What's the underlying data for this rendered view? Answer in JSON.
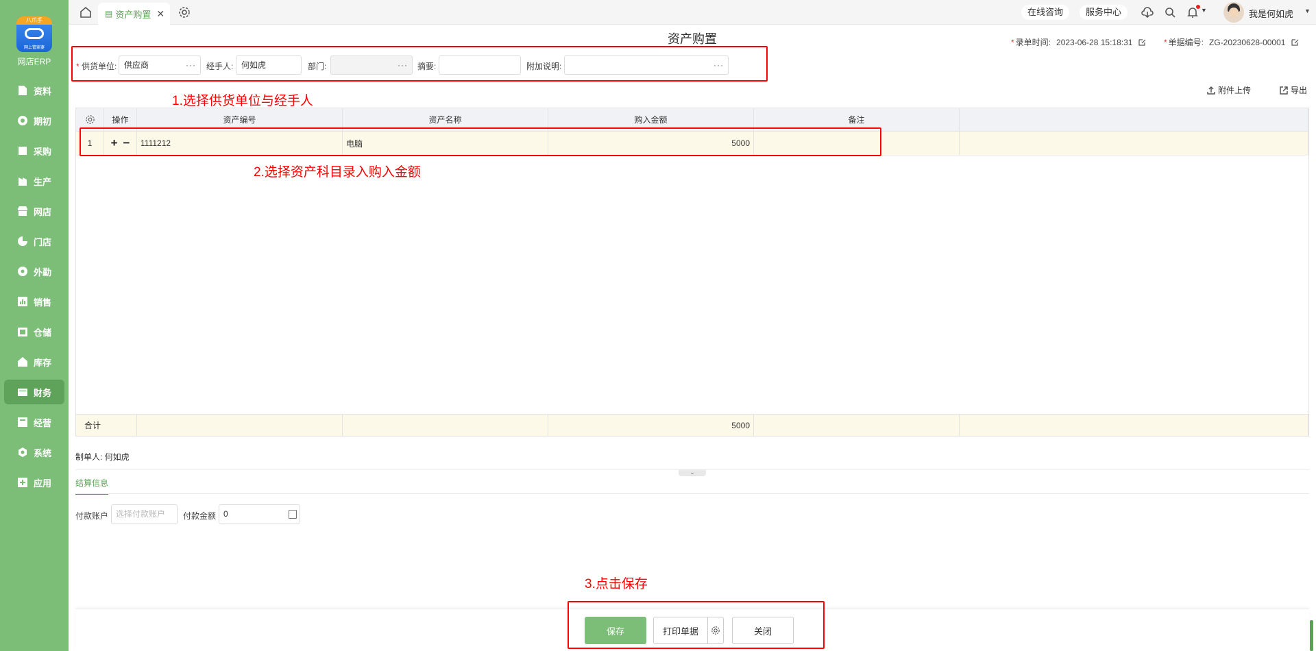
{
  "sidebar": {
    "logo_ribbon": "八爪手",
    "logo_sub": "网上管家婆",
    "brand": "网店ERP",
    "items": [
      {
        "label": "资料",
        "icon": "file-icon"
      },
      {
        "label": "期初",
        "icon": "target-icon"
      },
      {
        "label": "采购",
        "icon": "cart-icon"
      },
      {
        "label": "生产",
        "icon": "factory-icon"
      },
      {
        "label": "网店",
        "icon": "shop-icon"
      },
      {
        "label": "门店",
        "icon": "pie-icon"
      },
      {
        "label": "外勤",
        "icon": "location-icon"
      },
      {
        "label": "销售",
        "icon": "chart-icon"
      },
      {
        "label": "仓储",
        "icon": "warehouse-icon"
      },
      {
        "label": "库存",
        "icon": "home-icon"
      },
      {
        "label": "财务",
        "icon": "wallet-icon",
        "active": true
      },
      {
        "label": "经营",
        "icon": "business-icon"
      },
      {
        "label": "系统",
        "icon": "hex-icon"
      },
      {
        "label": "应用",
        "icon": "plus-icon"
      }
    ]
  },
  "topbar": {
    "tab_label": "资产购置",
    "consult": "在线咨询",
    "service": "服务中心",
    "user": "我是何如虎"
  },
  "page": {
    "title": "资产购置",
    "entry_time_label": "录单时间:",
    "entry_time": "2023-06-28 15:18:31",
    "doc_no_label": "单据编号:",
    "doc_no": "ZG-20230628-00001"
  },
  "form": {
    "supplier_label": "供货单位:",
    "supplier_value": "供应商",
    "handler_label": "经手人:",
    "handler_value": "何如虎",
    "dept_label": "部门:",
    "summary_label": "摘要:",
    "note_label": "附加说明:"
  },
  "tools": {
    "attach": "附件上传",
    "export": "导出"
  },
  "annotations": {
    "step1": "1.选择供货单位与经手人",
    "step2": "2.选择资产科目录入购入金额",
    "step3": "3.点击保存"
  },
  "table": {
    "headers": [
      "操作",
      "资产编号",
      "资产名称",
      "购入金额",
      "备注"
    ],
    "rows": [
      {
        "index": "1",
        "code": "1111212",
        "name": "电脑",
        "amount": "5000",
        "note": ""
      }
    ],
    "total_label": "合计",
    "total_amount": "5000"
  },
  "maker": "制单人: 何如虎",
  "settlement": {
    "tab": "结算信息",
    "account_label": "付款账户",
    "account_placeholder": "选择付款账户",
    "amount_label": "付款金额",
    "amount_value": "0"
  },
  "buttons": {
    "save": "保存",
    "print": "打印单据",
    "close": "关闭"
  },
  "colors": {
    "accent": "#7cbd78",
    "annotation": "#ff0000",
    "row_highlight": "#fdf9e9"
  }
}
